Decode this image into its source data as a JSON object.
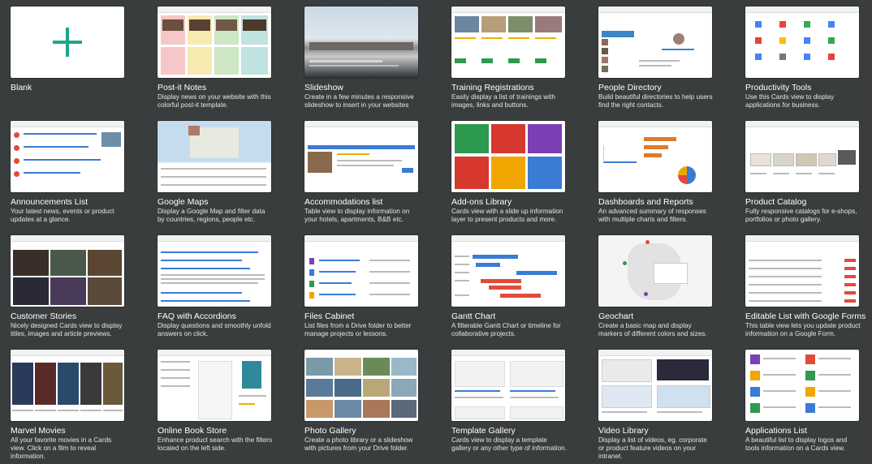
{
  "colors": {
    "background": "#3a3d3e",
    "accent": "#1fa58c"
  },
  "cards": [
    {
      "title": "Blank",
      "desc": ""
    },
    {
      "title": "Post-it Notes",
      "desc": "Display news on your website with this colorful post-it template."
    },
    {
      "title": "Slideshow",
      "desc": "Create in a few minutes a responsive slideshow to insert in your websites"
    },
    {
      "title": "Training Registrations",
      "desc": "Easily display a list of trainings with images, links and buttons."
    },
    {
      "title": "People Directory",
      "desc": "Build beautiful directories to help users find the right contacts."
    },
    {
      "title": "Productivity Tools",
      "desc": "Use this Cards view to display applications for business."
    },
    {
      "title": "Announcements List",
      "desc": "Your latest news, events or product updates at a glance."
    },
    {
      "title": "Google Maps",
      "desc": "Display a Google Map and filter data by countries, regions, people etc."
    },
    {
      "title": "Accommodations list",
      "desc": "Table view to display information on your hotels, apartments, B&B etc."
    },
    {
      "title": "Add-ons Library",
      "desc": "Cards view with a slide up information layer to present products and more."
    },
    {
      "title": "Dashboards and Reports",
      "desc": "An advanced summary of responses with multiple charts and filters."
    },
    {
      "title": "Product Catalog",
      "desc": "Fully responsive catalogs for e-shops, portfolios or photo gallery."
    },
    {
      "title": "Customer Stories",
      "desc": "Nicely designed Cards view to display titles, images and article previews."
    },
    {
      "title": "FAQ with Accordions",
      "desc": "Display questions and smoothly unfold answers on click."
    },
    {
      "title": "Files Cabinet",
      "desc": "List files from a Drive folder to better manage projects or lessons."
    },
    {
      "title": "Gantt Chart",
      "desc": "A filterable Gantt Chart or timeline for collaborative projects."
    },
    {
      "title": "Geochart",
      "desc": "Create a basic map and display markers of different colors and sizes."
    },
    {
      "title": "Editable List with Google Forms",
      "desc": "This table view lets you update product information on a Google Form."
    },
    {
      "title": "Marvel Movies",
      "desc": "All your favorite movies in a Cards view. Click on a film to reveal information."
    },
    {
      "title": "Online Book Store",
      "desc": "Enhance product search with the filters located on the left side."
    },
    {
      "title": "Photo Gallery",
      "desc": "Create a photo library or a slideshow with pictures from your Drive folder."
    },
    {
      "title": "Template Gallery",
      "desc": "Cards view to display a template gallery or any other type of information."
    },
    {
      "title": "Video Library",
      "desc": "Display a list of videos, eg. corporate or product feature videos on your intranet."
    },
    {
      "title": "Applications List",
      "desc": "A beautiful list to display logos and tools information on a Cards view."
    }
  ],
  "thumbs": {
    "blank_icon": "plus-icon"
  }
}
